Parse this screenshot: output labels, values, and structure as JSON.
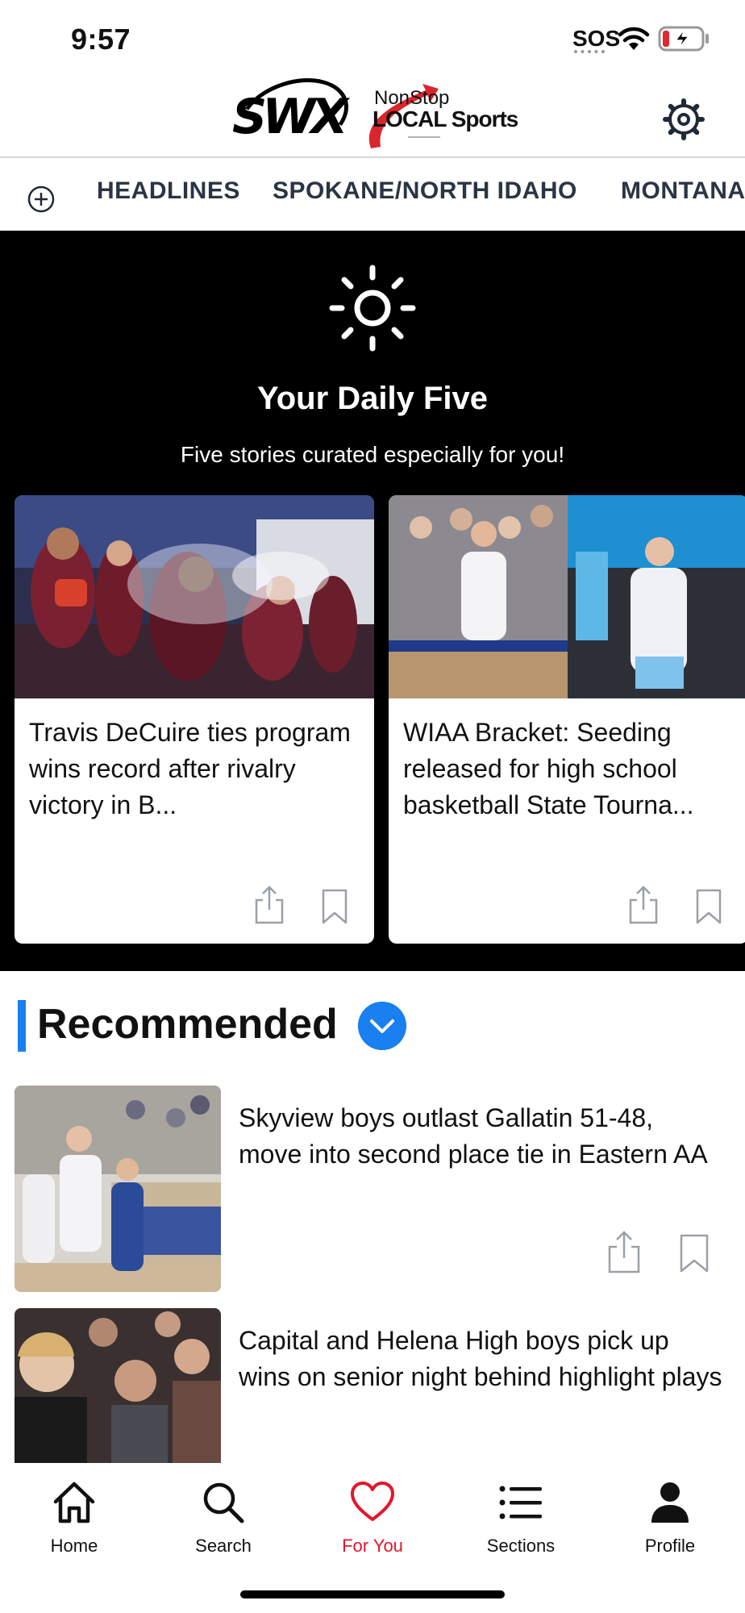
{
  "status_bar": {
    "time": "9:57",
    "sos": "SOS"
  },
  "header": {
    "logo_main": "SWX",
    "logo_sub_line1": "NonStop",
    "logo_sub_line2": "LOCAL Sports"
  },
  "section_nav": {
    "tabs": [
      "HEADLINES",
      "SPOKANE/NORTH IDAHO",
      "MONTANA"
    ]
  },
  "daily_five": {
    "title": "Your Daily Five",
    "subtitle": "Five stories curated especially for you!",
    "stories": [
      {
        "title": "Travis DeCuire ties program wins record after rivalry victory in B..."
      },
      {
        "title": "WIAA Bracket: Seeding released for high school basketball State Tourna..."
      }
    ]
  },
  "recommended": {
    "title": "Recommended",
    "items": [
      {
        "title": "Skyview boys outlast Gallatin 51-48, move into second place tie in Eastern AA"
      },
      {
        "title": "Capital and Helena High boys pick up wins on senior night behind highlight plays"
      }
    ]
  },
  "tab_bar": {
    "items": [
      {
        "label": "Home",
        "icon": "home-icon"
      },
      {
        "label": "Search",
        "icon": "search-icon"
      },
      {
        "label": "For You",
        "icon": "heart-icon",
        "active": true
      },
      {
        "label": "Sections",
        "icon": "list-icon"
      },
      {
        "label": "Profile",
        "icon": "person-icon"
      }
    ]
  },
  "colors": {
    "accent_blue": "#1a7ff0",
    "active_red": "#e0182d",
    "daily_bg": "#000000"
  }
}
